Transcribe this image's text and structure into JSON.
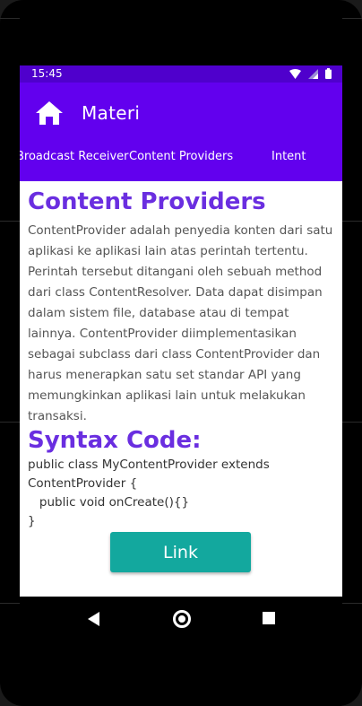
{
  "status_bar": {
    "time": "15:45"
  },
  "app_bar": {
    "title": "Materi"
  },
  "tabs": [
    {
      "label": "Broadcast Receiver"
    },
    {
      "label": "Content Providers"
    },
    {
      "label": "Intent"
    }
  ],
  "content": {
    "heading": "Content Providers",
    "paragraph": "ContentProvider adalah penyedia konten dari satu aplikasi ke aplikasi lain atas perintah tertentu. Perintah tersebut ditangani oleh sebuah method dari class ContentResolver. Data dapat disimpan dalam sistem file, database atau di tempat lainnya. ContentProvider diimplementasikan sebagai subclass dari class ContentProvider dan harus menerapkan satu set standar API yang memungkinkan aplikasi lain untuk melakukan transaksi.",
    "syntax_heading": "Syntax Code:",
    "code": "public class MyContentProvider extends\nContentProvider {\n   public void onCreate(){}\n}"
  },
  "link_button": {
    "label": "Link"
  },
  "colors": {
    "status_bar": "#4f00cc",
    "app_bar": "#6200ee",
    "heading": "#6a2ee0",
    "button": "#13a89e"
  }
}
